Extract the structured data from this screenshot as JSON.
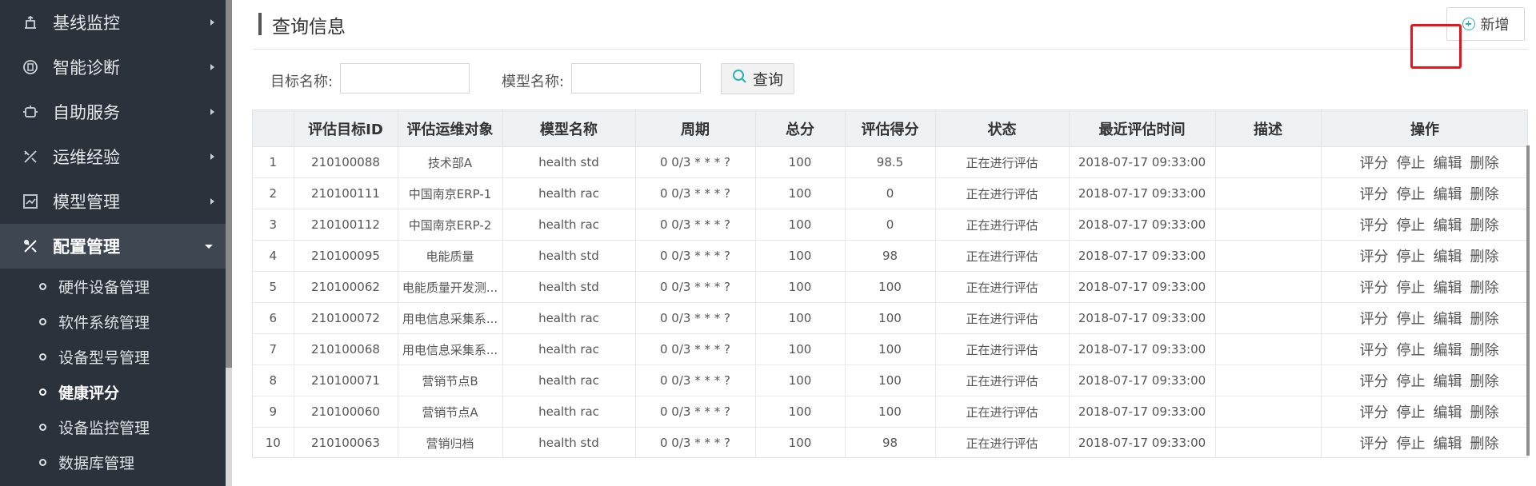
{
  "sidebar": {
    "menu": [
      {
        "label": "基线监控",
        "icon": "monitor-icon"
      },
      {
        "label": "智能诊断",
        "icon": "diagnosis-icon"
      },
      {
        "label": "自助服务",
        "icon": "robot-icon"
      },
      {
        "label": "运维经验",
        "icon": "tools-icon"
      },
      {
        "label": "模型管理",
        "icon": "chart-icon"
      },
      {
        "label": "配置管理",
        "icon": "config-icon",
        "active": true
      }
    ],
    "submenu": [
      {
        "label": "硬件设备管理"
      },
      {
        "label": "软件系统管理"
      },
      {
        "label": "设备型号管理"
      },
      {
        "label": "健康评分",
        "active": true
      },
      {
        "label": "设备监控管理"
      },
      {
        "label": "数据库管理"
      }
    ]
  },
  "header": {
    "title": "查询信息",
    "add_label": "新增"
  },
  "filters": {
    "target_label": "目标名称:",
    "target_value": "",
    "model_label": "模型名称:",
    "model_value": "",
    "query_label": "查询"
  },
  "table": {
    "columns": [
      "",
      "评估目标ID",
      "评估运维对象",
      "模型名称",
      "周期",
      "总分",
      "评估得分",
      "状态",
      "最近评估时间",
      "描述",
      "操作"
    ],
    "actions": [
      "评分",
      "停止",
      "编辑",
      "删除"
    ],
    "rows": [
      [
        "1",
        "210100088",
        "技术部A",
        "health std",
        "0 0/3 * * * ?",
        "100",
        "98.5",
        "正在进行评估",
        "2018-07-17 09:33:00",
        ""
      ],
      [
        "2",
        "210100111",
        "中国南京ERP-1",
        "health rac",
        "0 0/3 * * * ?",
        "100",
        "0",
        "正在进行评估",
        "2018-07-17 09:33:00",
        ""
      ],
      [
        "3",
        "210100112",
        "中国南京ERP-2",
        "health rac",
        "0 0/3 * * * ?",
        "100",
        "0",
        "正在进行评估",
        "2018-07-17 09:33:00",
        ""
      ],
      [
        "4",
        "210100095",
        "电能质量",
        "health std",
        "0 0/3 * * * ?",
        "100",
        "98",
        "正在进行评估",
        "2018-07-17 09:33:00",
        ""
      ],
      [
        "5",
        "210100062",
        "电能质量开发测...",
        "health std",
        "0 0/3 * * * ?",
        "100",
        "100",
        "正在进行评估",
        "2018-07-17 09:33:00",
        ""
      ],
      [
        "6",
        "210100072",
        "用电信息采集系...",
        "health rac",
        "0 0/3 * * * ?",
        "100",
        "100",
        "正在进行评估",
        "2018-07-17 09:33:00",
        ""
      ],
      [
        "7",
        "210100068",
        "用电信息采集系...",
        "health rac",
        "0 0/3 * * * ?",
        "100",
        "100",
        "正在进行评估",
        "2018-07-17 09:33:00",
        ""
      ],
      [
        "8",
        "210100071",
        "营销节点B",
        "health rac",
        "0 0/3 * * * ?",
        "100",
        "100",
        "正在进行评估",
        "2018-07-17 09:33:00",
        ""
      ],
      [
        "9",
        "210100060",
        "营销节点A",
        "health rac",
        "0 0/3 * * * ?",
        "100",
        "100",
        "正在进行评估",
        "2018-07-17 09:33:00",
        ""
      ],
      [
        "10",
        "210100063",
        "营销归档",
        "health std",
        "0 0/3 * * * ?",
        "100",
        "98",
        "正在进行评估",
        "2018-07-17 09:33:00",
        ""
      ]
    ]
  },
  "colors": {
    "sidebar_bg": "#2b323c",
    "active_bg": "#3e4652",
    "header_bg": "#eef1f4",
    "highlight": "#e8141c",
    "accent": "#2ab3b3"
  }
}
